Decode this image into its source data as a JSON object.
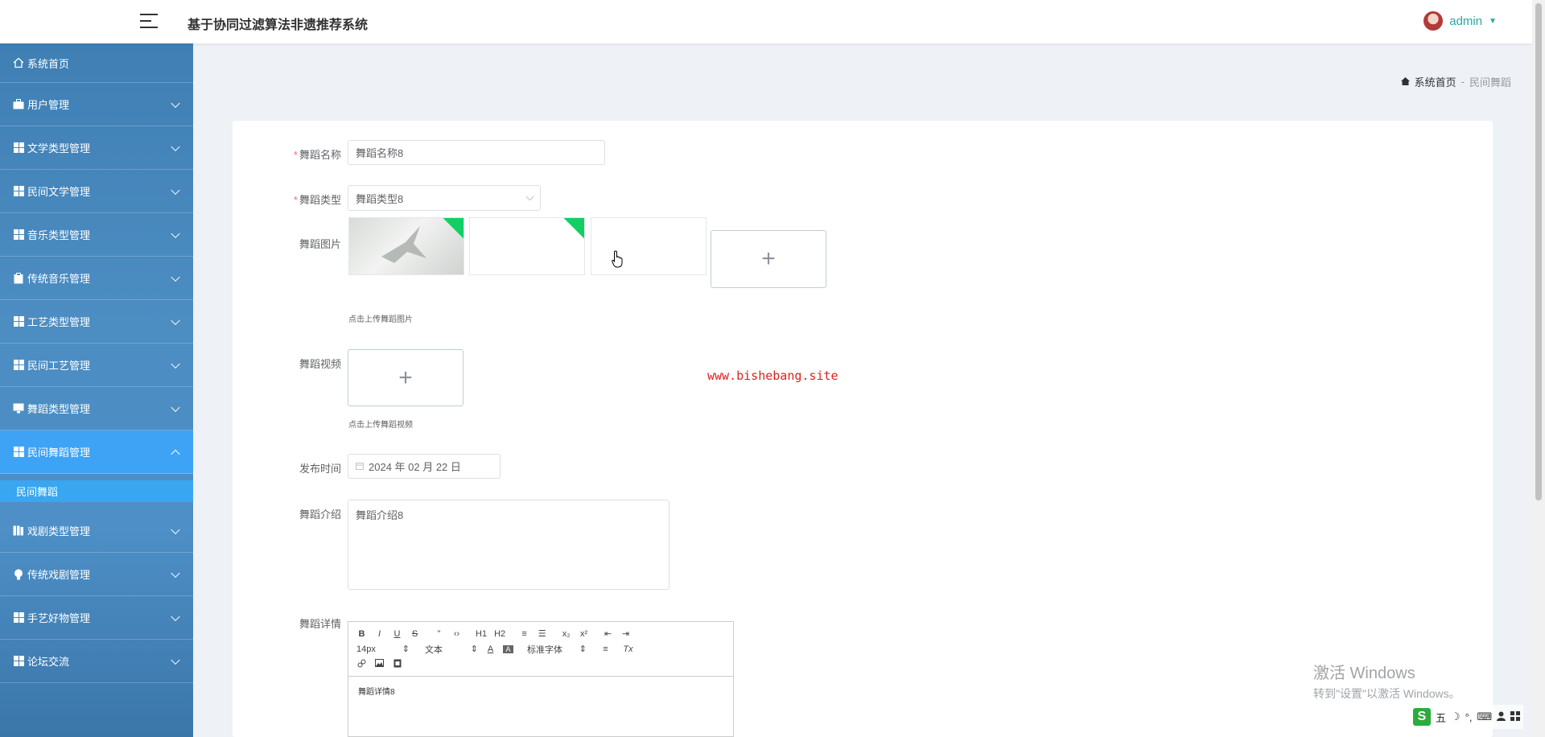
{
  "header": {
    "app_title": "基于协同过滤算法非遗推荐系统",
    "user_name": "admin"
  },
  "sidebar": {
    "home": "系统首页",
    "items": [
      {
        "label": "用户管理",
        "icon": "briefcase-icon"
      },
      {
        "label": "文学类型管理",
        "icon": "grid-icon"
      },
      {
        "label": "民间文学管理",
        "icon": "grid-icon"
      },
      {
        "label": "音乐类型管理",
        "icon": "grid-icon"
      },
      {
        "label": "传统音乐管理",
        "icon": "clipboard-icon"
      },
      {
        "label": "工艺类型管理",
        "icon": "grid-icon"
      },
      {
        "label": "民间工艺管理",
        "icon": "grid-icon"
      },
      {
        "label": "舞蹈类型管理",
        "icon": "monitor-icon"
      },
      {
        "label": "民间舞蹈管理",
        "icon": "grid-icon"
      },
      {
        "label": "戏剧类型管理",
        "icon": "book-icon"
      },
      {
        "label": "传统戏剧管理",
        "icon": "bulb-icon"
      },
      {
        "label": "手艺好物管理",
        "icon": "grid-icon"
      },
      {
        "label": "论坛交流",
        "icon": "grid-icon"
      }
    ],
    "sub_item": "民间舞蹈"
  },
  "breadcrumb": {
    "home": "系统首页",
    "separator": "-",
    "current": "民间舞蹈"
  },
  "form": {
    "name_label": "舞蹈名称",
    "name_value": "舞蹈名称8",
    "type_label": "舞蹈类型",
    "type_value": "舞蹈类型8",
    "images_label": "舞蹈图片",
    "images_hint": "点击上传舞蹈图片",
    "video_label": "舞蹈视频",
    "video_hint": "点击上传舞蹈视频",
    "date_label": "发布时间",
    "date_value": "2024 年 02 月 22 日",
    "intro_label": "舞蹈介绍",
    "intro_value": "舞蹈介绍8",
    "detail_label": "舞蹈详情",
    "detail_content": "舞蹈详情8",
    "plus": "+"
  },
  "editor": {
    "row1": [
      "B",
      "I",
      "U",
      "S",
      "”",
      "‹›",
      "H1",
      "H2",
      "≡",
      "☰",
      "x₂",
      "x²",
      "⇤",
      "⇥"
    ],
    "size": "14px",
    "header": "文本",
    "font": "标准字体",
    "align": "≡",
    "clear": "Tx"
  },
  "watermark_url": "www.bishebang.site",
  "windows": {
    "line1": "激活 Windows",
    "line2": "转到\"设置\"以激活 Windows。"
  },
  "tray": {
    "ime": "五",
    "moon": "☽",
    "punct": "°,",
    "keyboard": "⌨"
  },
  "colors": {
    "sidebar": "#4c8dc2",
    "active": "#3ea3f5",
    "accent": "#2aa7a0"
  }
}
